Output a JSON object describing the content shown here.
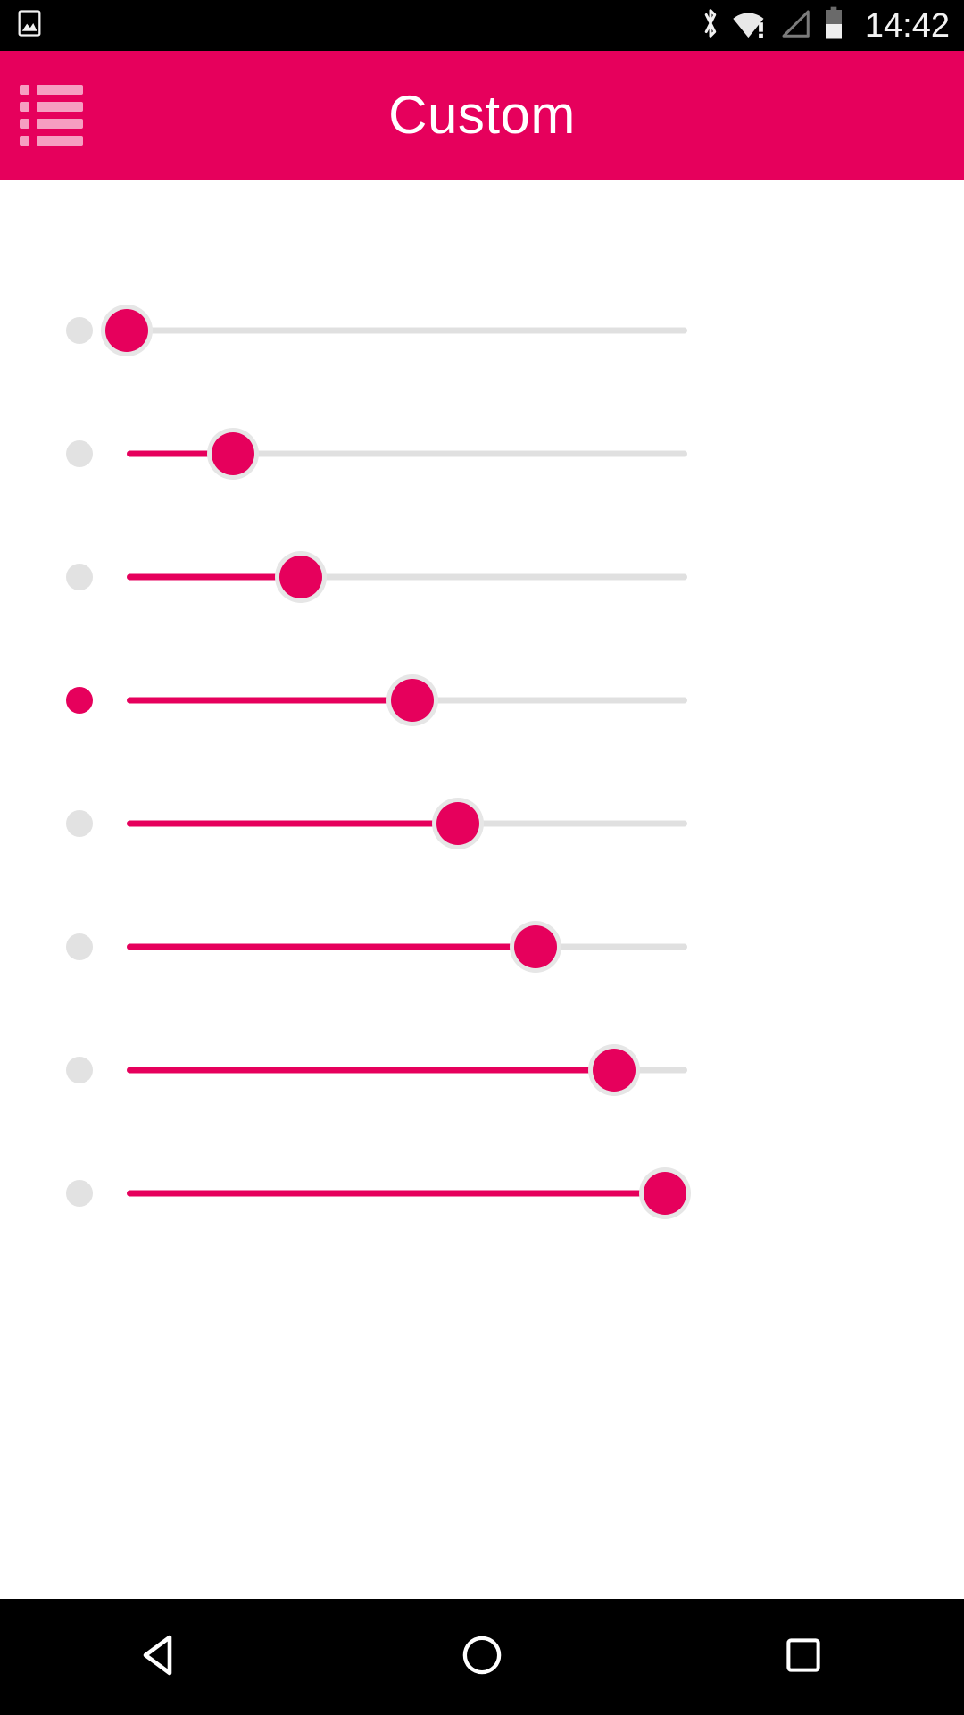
{
  "status_bar": {
    "time": "14:42",
    "left_icons": [
      {
        "name": "photo-icon",
        "glyph": "image"
      }
    ],
    "right_icons": [
      {
        "name": "bluetooth-icon",
        "glyph": "bluetooth"
      },
      {
        "name": "wifi-warning-icon",
        "glyph": "wifi-exclamation"
      },
      {
        "name": "cellular-signal-icon",
        "glyph": "signal-empty"
      },
      {
        "name": "battery-icon",
        "glyph": "battery-half"
      }
    ],
    "background_color": "#000000",
    "foreground_color": "#f2f2f2"
  },
  "app_bar": {
    "title": "Custom",
    "menu_icon": "list-icon",
    "background_color": "#E6005C",
    "title_color": "#FFFFFF"
  },
  "theme": {
    "accent_color": "#E6005C",
    "track_inactive_color": "#E0E0E0",
    "thumb_halo_color": "#E6E6E6",
    "indicator_off_color": "#E2E2E2",
    "page_background": "#FFFFFF"
  },
  "sliders": [
    {
      "name": "slider-1",
      "value": 0,
      "indicator_active": false
    },
    {
      "name": "slider-2",
      "value": 19,
      "indicator_active": false
    },
    {
      "name": "slider-3",
      "value": 31,
      "indicator_active": false
    },
    {
      "name": "slider-4",
      "value": 51,
      "indicator_active": true
    },
    {
      "name": "slider-5",
      "value": 59,
      "indicator_active": false
    },
    {
      "name": "slider-6",
      "value": 73,
      "indicator_active": false
    },
    {
      "name": "slider-7",
      "value": 87,
      "indicator_active": false
    },
    {
      "name": "slider-8",
      "value": 96,
      "indicator_active": false
    }
  ],
  "nav_bar": {
    "buttons": [
      {
        "name": "back-button",
        "icon": "triangle-left-icon"
      },
      {
        "name": "home-button",
        "icon": "circle-icon"
      },
      {
        "name": "recents-button",
        "icon": "square-icon"
      }
    ],
    "background_color": "#000000",
    "icon_color": "#FFFFFF"
  }
}
